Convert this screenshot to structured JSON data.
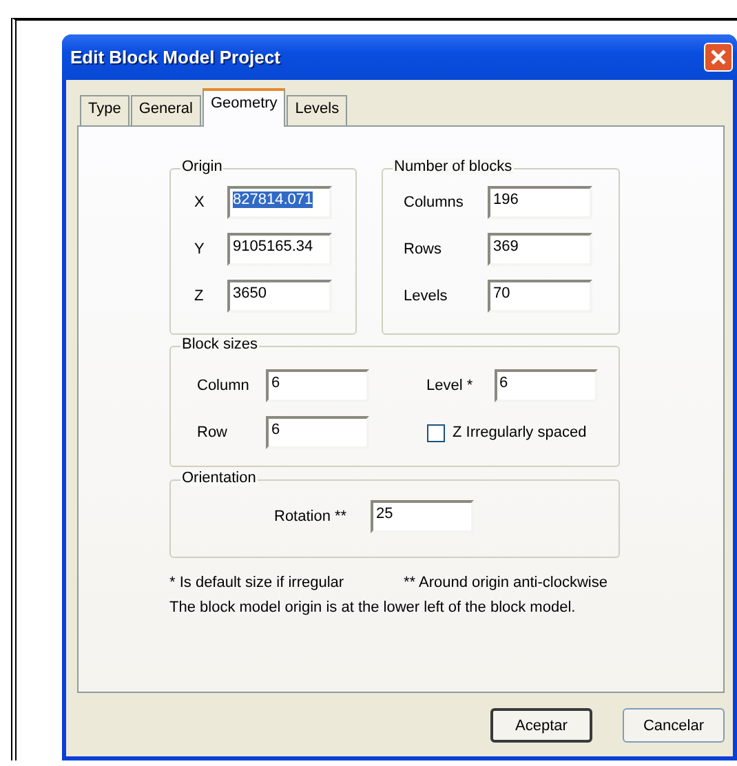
{
  "window": {
    "title": "Edit Block Model Project"
  },
  "tabs": [
    {
      "label": "Type",
      "selected": false
    },
    {
      "label": "General",
      "selected": false
    },
    {
      "label": "Geometry",
      "selected": true
    },
    {
      "label": "Levels",
      "selected": false
    }
  ],
  "origin": {
    "title": "Origin",
    "fields": [
      {
        "label": "X",
        "value": "827814.071",
        "selected": true
      },
      {
        "label": "Y",
        "value": "9105165.34",
        "selected": false
      },
      {
        "label": "Z",
        "value": "3650",
        "selected": false
      }
    ]
  },
  "number_of_blocks": {
    "title": "Number of blocks",
    "fields": [
      {
        "label": "Columns",
        "value": "196"
      },
      {
        "label": "Rows",
        "value": "369"
      },
      {
        "label": "Levels",
        "value": "70"
      }
    ]
  },
  "block_sizes": {
    "title": "Block sizes",
    "column": {
      "label": "Column",
      "value": "6"
    },
    "level": {
      "label": "Level *",
      "value": "6"
    },
    "row": {
      "label": "Row",
      "value": "6"
    },
    "irregular": {
      "label": "Z Irregularly spaced",
      "checked": false
    }
  },
  "orientation": {
    "title": "Orientation",
    "rotation": {
      "label": "Rotation **",
      "value": "25"
    }
  },
  "notes": [
    "* Is default size if irregular",
    "** Around origin anti-clockwise",
    "The block model origin is at the lower left of the block model."
  ],
  "buttons": [
    {
      "label": "Aceptar",
      "default": true
    },
    {
      "label": "Cancelar",
      "default": false
    }
  ]
}
